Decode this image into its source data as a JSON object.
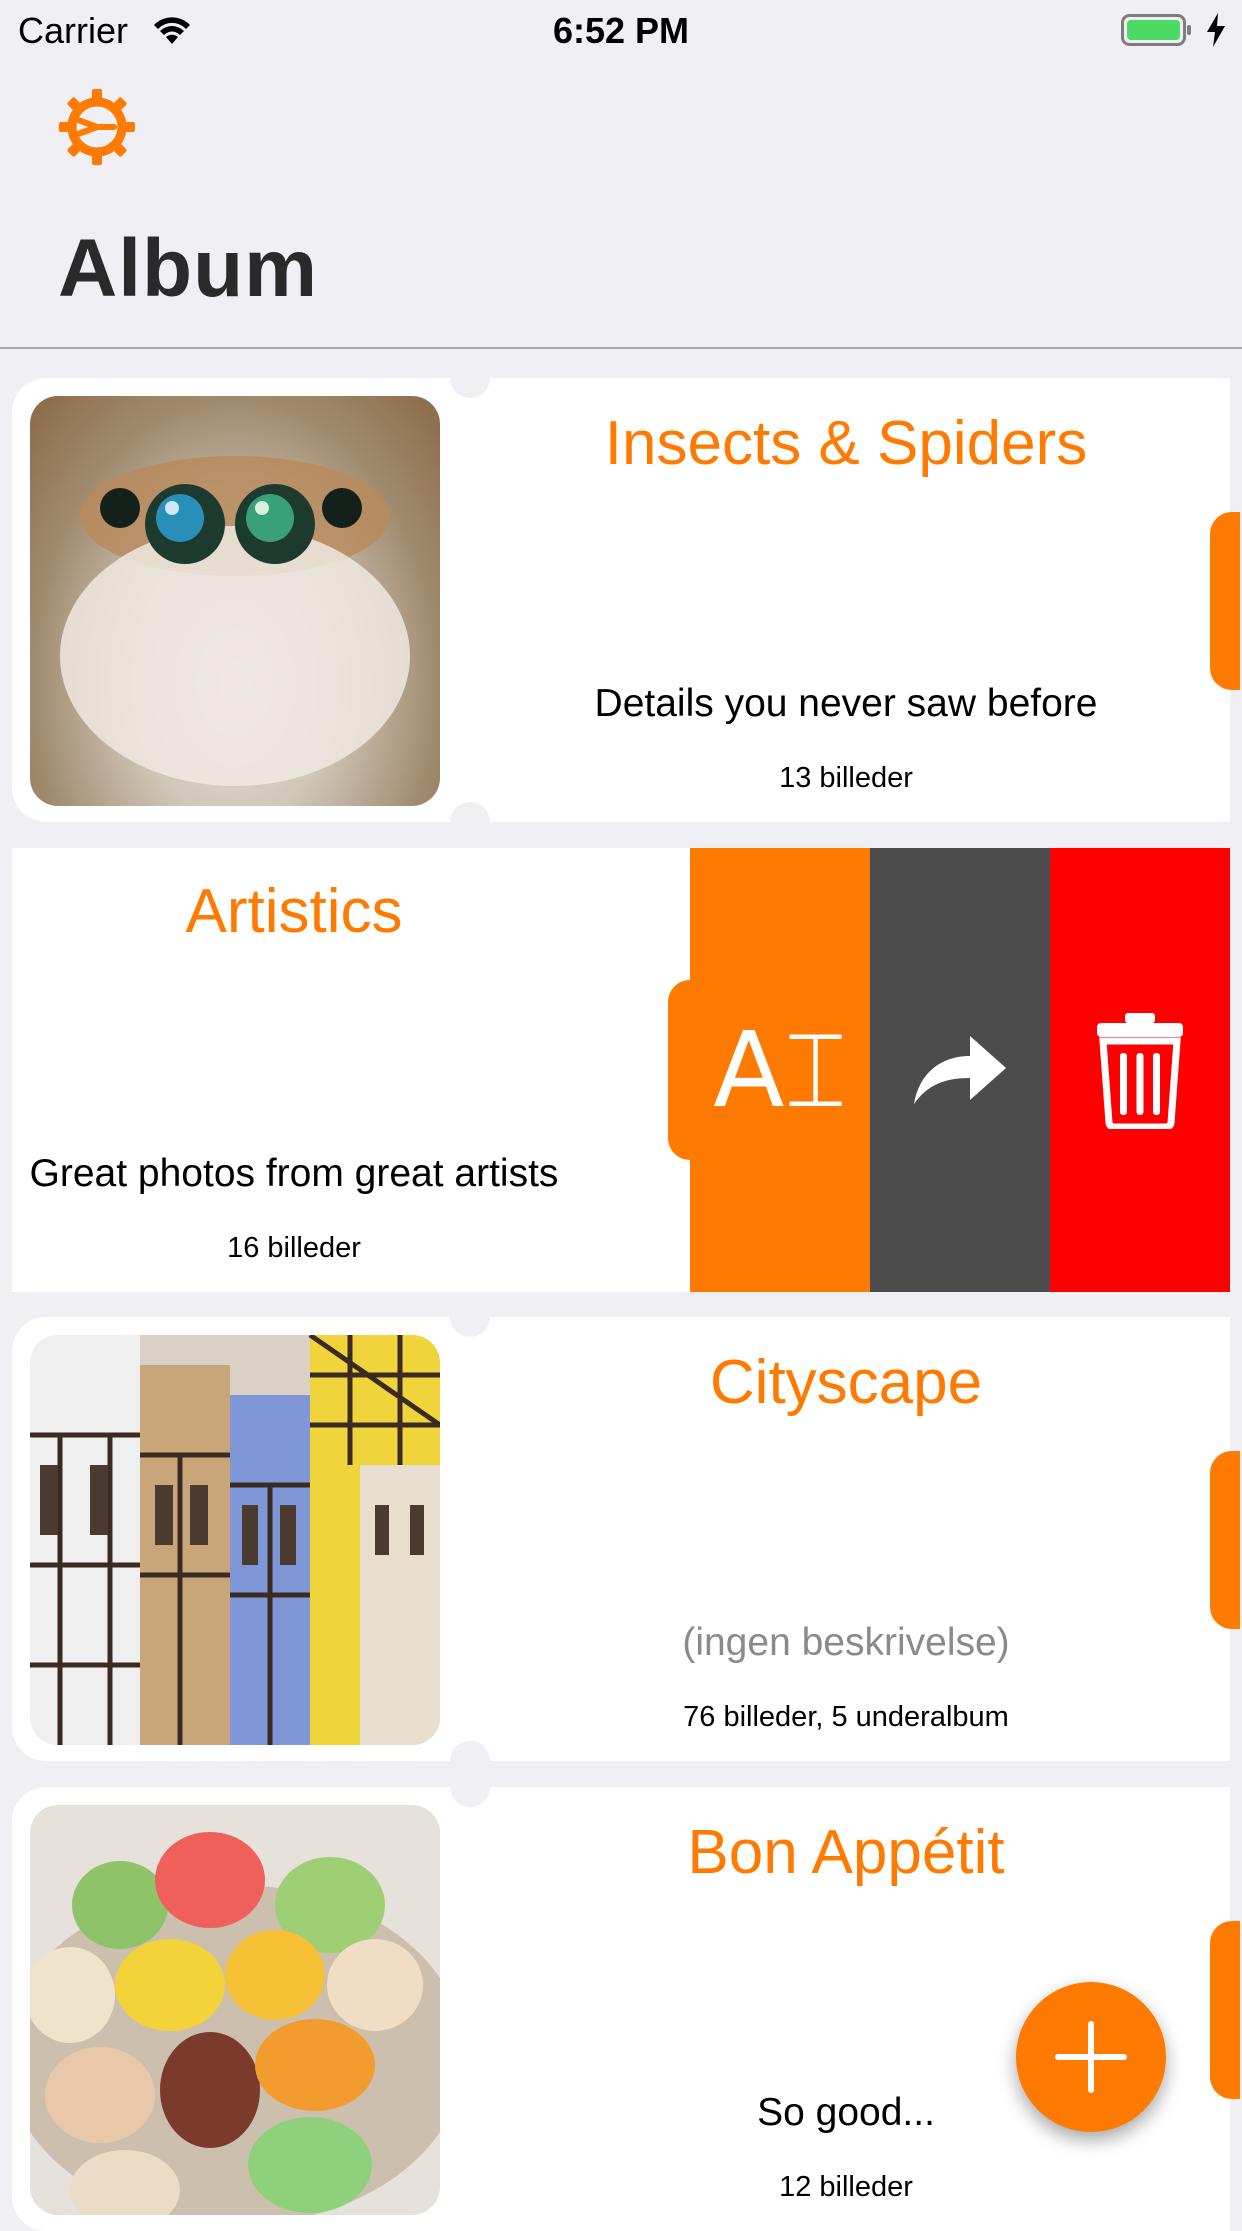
{
  "status_bar": {
    "carrier": "Carrier",
    "time": "6:52 PM",
    "battery_color": "#4cd964"
  },
  "nav": {
    "title": "Album",
    "settings_icon": "gear-icon"
  },
  "theme": {
    "accent": "#ff7a00",
    "delete": "#ff0000",
    "share": "#4c4c4c"
  },
  "albums": [
    {
      "title": "Insects & Spiders",
      "description": "Details you never saw before",
      "count": "13 billeder",
      "thumbnail": "spider-photo"
    },
    {
      "title": "Artistics",
      "description": "Great photos from great artists",
      "count": "16 billeder",
      "thumbnail": ""
    },
    {
      "title": "Cityscape",
      "description": "(ingen beskrivelse)",
      "count": "76 billeder, 5 underalbum",
      "thumbnail": "half-timbered-houses-photo"
    },
    {
      "title": "Bon Appétit",
      "description": "So good...",
      "count": "12 billeder",
      "thumbnail": "macarons-photo"
    }
  ],
  "swipe_actions": [
    {
      "name": "rename",
      "icon": "rename-icon",
      "glyph": "A⌶"
    },
    {
      "name": "share",
      "icon": "share-arrow-icon"
    },
    {
      "name": "delete",
      "icon": "trash-icon"
    }
  ],
  "fab": {
    "icon": "plus-icon"
  }
}
